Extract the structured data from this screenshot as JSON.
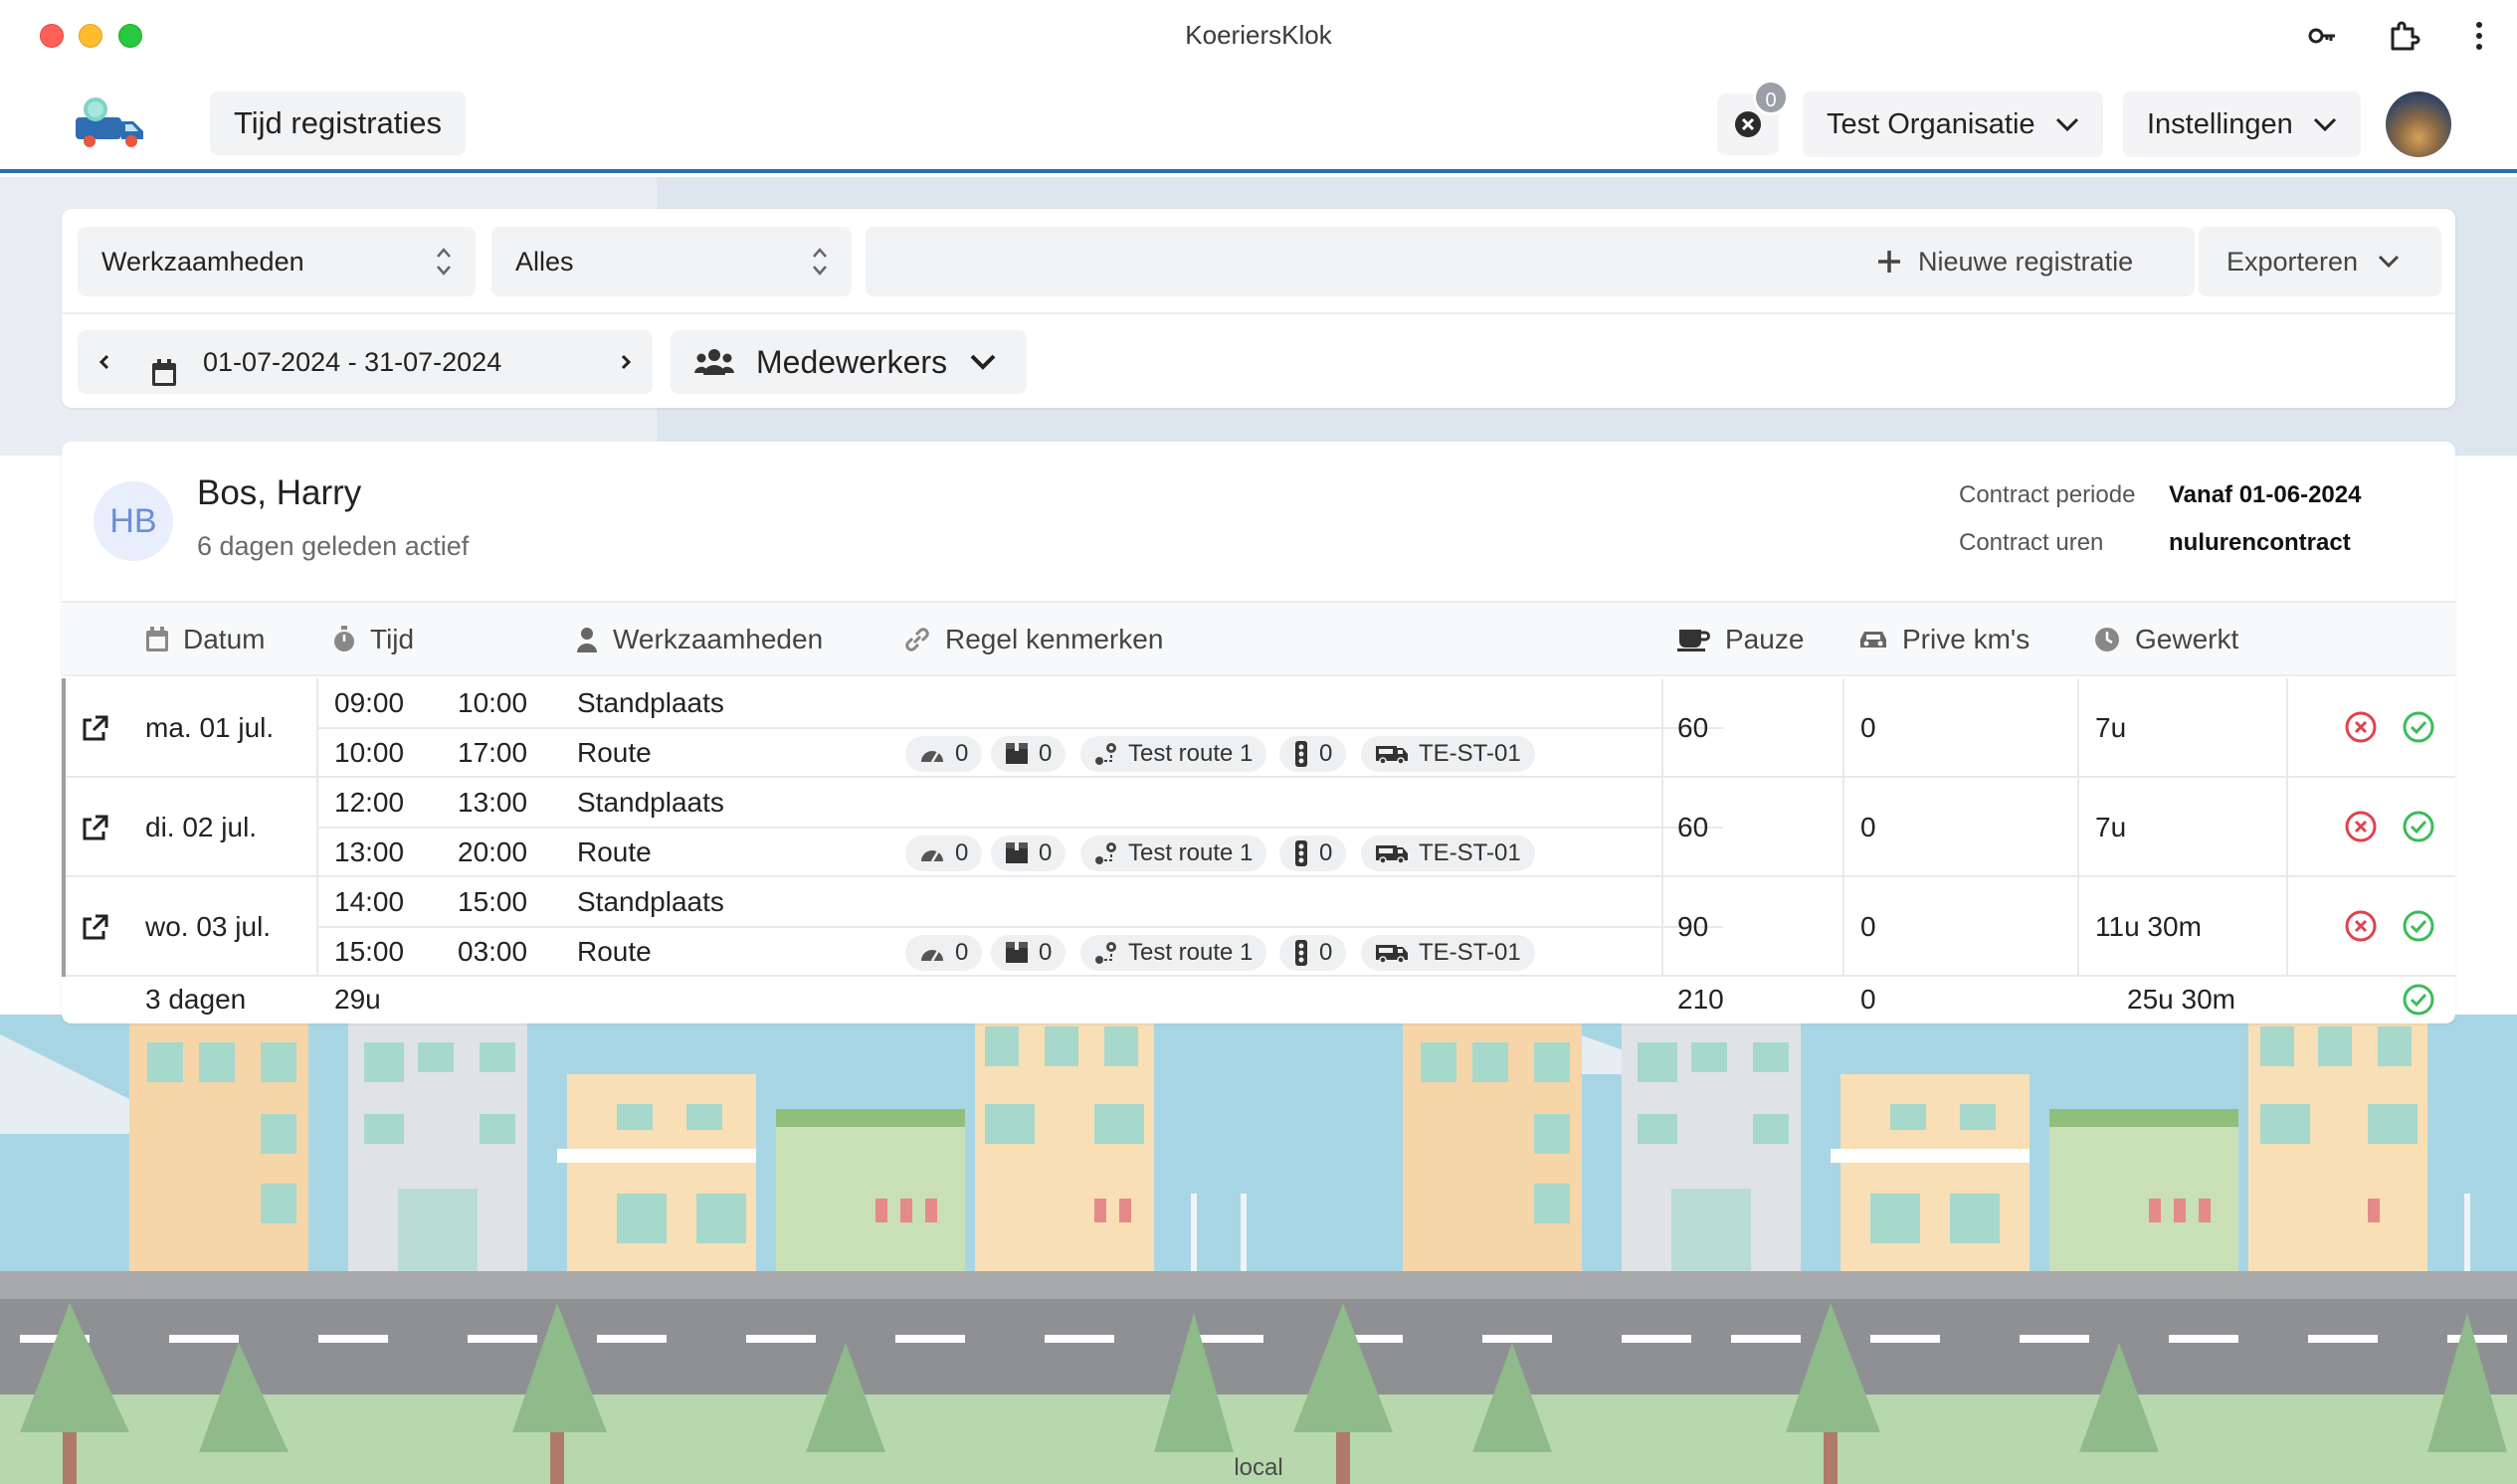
{
  "window": {
    "title": "KoeriersKlok"
  },
  "header": {
    "nav_tab": "Tijd registraties",
    "notification_count": "0",
    "organization": "Test Organisatie",
    "settings": "Instellingen"
  },
  "filters": {
    "activity_select": "Werkzaamheden",
    "scope_select": "Alles",
    "search_value": "",
    "new_registration": "Nieuwe registratie",
    "export": "Exporteren",
    "date_range": "01-07-2024 - 31-07-2024",
    "employees": "Medewerkers"
  },
  "employee": {
    "initials": "HB",
    "name": "Bos, Harry",
    "last_active": "6 dagen geleden actief",
    "contract_period_label": "Contract periode",
    "contract_period_value": "Vanaf 01-06-2024",
    "contract_hours_label": "Contract uren",
    "contract_hours_value": "nulurencontract"
  },
  "table": {
    "headers": {
      "date": "Datum",
      "time": "Tijd",
      "activities": "Werkzaamheden",
      "rule_features": "Regel kenmerken",
      "pause": "Pauze",
      "private_km": "Prive km's",
      "worked": "Gewerkt"
    },
    "rows": [
      {
        "day": "ma. 01 jul.",
        "lines": [
          {
            "start": "09:00",
            "end": "10:00",
            "activity": "Standplaats"
          },
          {
            "start": "10:00",
            "end": "17:00",
            "activity": "Route"
          }
        ],
        "chips": {
          "speed": "0",
          "packages": "0",
          "route": "Test route 1",
          "traffic": "0",
          "vehicle": "TE-ST-01"
        },
        "pause": "60",
        "private_km": "0",
        "worked": "7u"
      },
      {
        "day": "di. 02 jul.",
        "lines": [
          {
            "start": "12:00",
            "end": "13:00",
            "activity": "Standplaats"
          },
          {
            "start": "13:00",
            "end": "20:00",
            "activity": "Route"
          }
        ],
        "chips": {
          "speed": "0",
          "packages": "0",
          "route": "Test route 1",
          "traffic": "0",
          "vehicle": "TE-ST-01"
        },
        "pause": "60",
        "private_km": "0",
        "worked": "7u"
      },
      {
        "day": "wo. 03 jul.",
        "lines": [
          {
            "start": "14:00",
            "end": "15:00",
            "activity": "Standplaats"
          },
          {
            "start": "15:00",
            "end": "03:00",
            "activity": "Route"
          }
        ],
        "chips": {
          "speed": "0",
          "packages": "0",
          "route": "Test route 1",
          "traffic": "0",
          "vehicle": "TE-ST-01"
        },
        "pause": "90",
        "private_km": "0",
        "worked": "11u 30m"
      }
    ],
    "totals": {
      "days": "3 dagen",
      "time": "29u",
      "pause": "210",
      "private_km": "0",
      "worked": "25u 30m"
    }
  },
  "footer": {
    "env": "local"
  },
  "colors": {
    "accent": "#2f6db3",
    "reject": "#e0434d",
    "approve": "#3dbb5a"
  }
}
